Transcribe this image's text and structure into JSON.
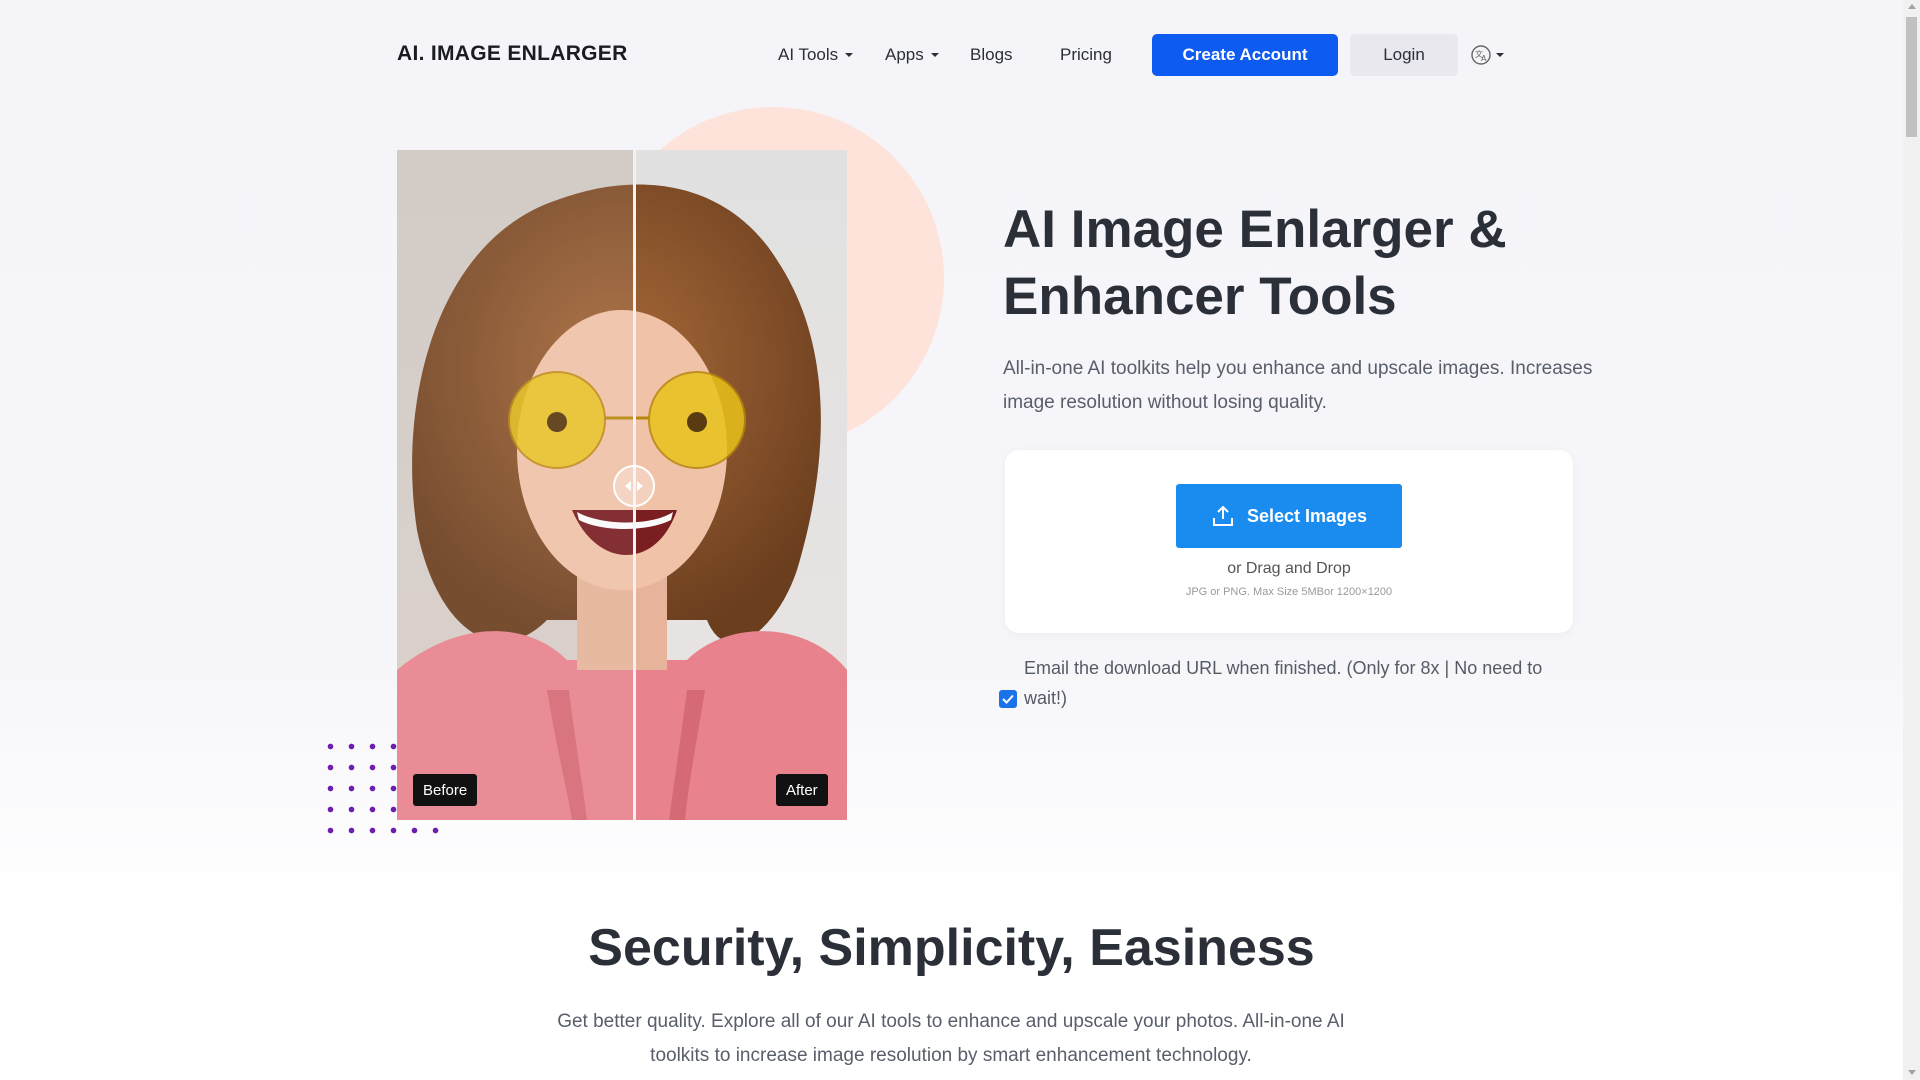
{
  "header": {
    "logo": "AI. IMAGE ENLARGER",
    "nav": [
      {
        "label": "AI Tools",
        "dropdown": true
      },
      {
        "label": "Apps",
        "dropdown": true
      },
      {
        "label": "Blogs",
        "dropdown": false
      },
      {
        "label": "Pricing",
        "dropdown": false
      }
    ],
    "create_account": "Create Account",
    "login": "Login",
    "language_icon": "translate-icon"
  },
  "hero": {
    "title": "AI Image Enlarger & Enhancer Tools",
    "subtitle": "All-in-one AI toolkits help you enhance and upscale images. Increases image resolution without losing quality.",
    "compare": {
      "before_label": "Before",
      "after_label": "After"
    },
    "upload": {
      "button": "Select Images",
      "button_icon": "upload-icon",
      "drag_text": "or Drag and Drop",
      "limits": "JPG or PNG. Max Size 5MBor 1200×1200"
    },
    "email_option": {
      "label": "Email the download URL when finished. (Only for 8x | No need to wait!)",
      "checked": true
    }
  },
  "section": {
    "title": "Security, Simplicity, Easiness",
    "subtitle": "Get better quality. Explore all of our AI tools to enhance and upscale your photos. All-in-one AI toolkits to increase image resolution by smart enhancement technology."
  },
  "colors": {
    "primary": "#0d5bf0",
    "upload_button": "#1a8cf0",
    "blob": "#fde3da",
    "dots": "#6e1fb0"
  }
}
